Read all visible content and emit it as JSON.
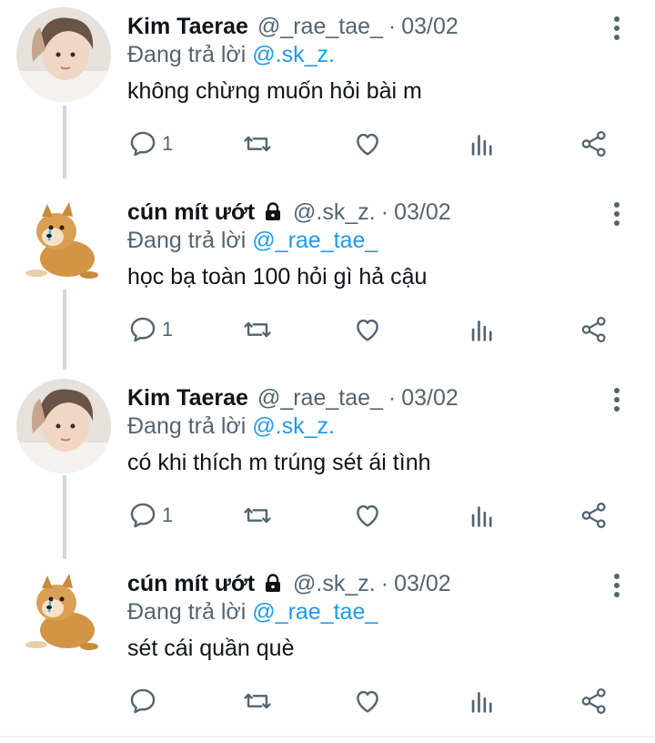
{
  "colors": {
    "accent": "#1d9bf0",
    "secondary_text": "#536471",
    "primary_text": "#0f1419",
    "thread_line": "#cfd9de"
  },
  "tweets": [
    {
      "name": "Kim Taerae",
      "handle": "@_rae_tae_",
      "separator": "·",
      "date": "03/02",
      "replying_prefix": "Đang trả lời",
      "replying_to": "@.sk_z.",
      "text": "không chừng muốn hỏi bài m",
      "reply_count": "1",
      "avatar": "person-avatar",
      "locked": false
    },
    {
      "name": "cún mít ướt",
      "handle": "@.sk_z.",
      "separator": "·",
      "date": "03/02",
      "replying_prefix": "Đang trả lời",
      "replying_to": "@_rae_tae_",
      "text": "học bạ toàn 100 hỏi gì hả cậu",
      "reply_count": "1",
      "avatar": "crying-dog-avatar",
      "locked": true
    },
    {
      "name": "Kim Taerae",
      "handle": "@_rae_tae_",
      "separator": "·",
      "date": "03/02",
      "replying_prefix": "Đang trả lời",
      "replying_to": "@.sk_z.",
      "text": "có khi thích m trúng sét ái tình",
      "reply_count": "1",
      "avatar": "person-avatar",
      "locked": false
    },
    {
      "name": "cún mít ướt",
      "handle": "@.sk_z.",
      "separator": "·",
      "date": "03/02",
      "replying_prefix": "Đang trả lời",
      "replying_to": "@_rae_tae_",
      "text": "sét cái quần què",
      "reply_count": "",
      "avatar": "crying-dog-avatar",
      "locked": true
    }
  ],
  "icons": [
    "reply-icon",
    "retweet-icon",
    "like-icon",
    "analytics-icon",
    "share-icon",
    "more-icon",
    "lock-icon"
  ]
}
